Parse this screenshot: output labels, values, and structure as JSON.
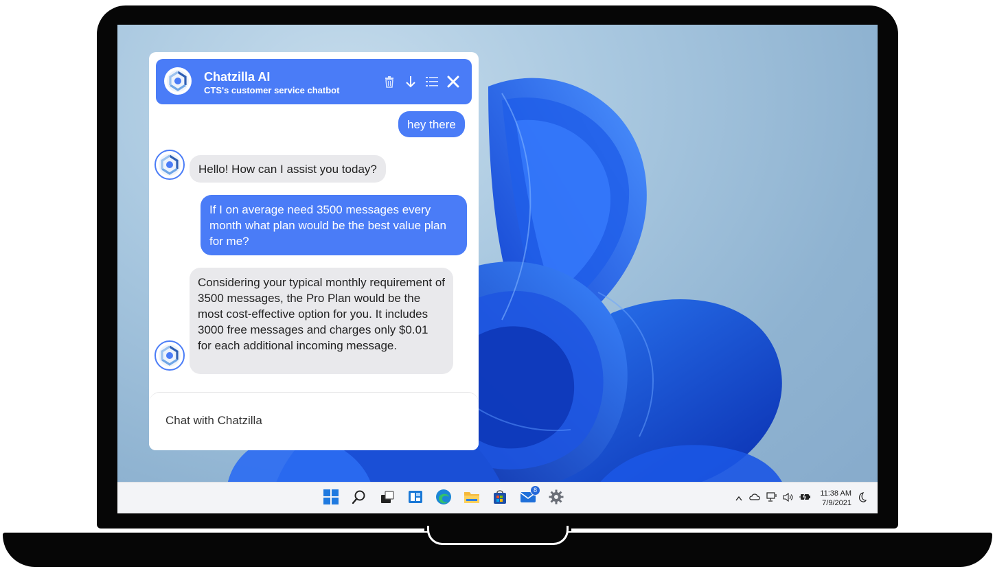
{
  "chat": {
    "title": "Chatzilla AI",
    "subtitle": "CTS's customer service chatbot",
    "messages": [
      {
        "role": "user",
        "text": "hey there"
      },
      {
        "role": "bot",
        "text": "Hello! How can I assist you today?"
      },
      {
        "role": "user",
        "text": "If I on average need 3500 messages every month what plan would be the best value plan for me?"
      },
      {
        "role": "bot",
        "text": "Considering your typical monthly requirement of 3500 messages, the Pro Plan would be the most cost-effective option for you. It includes 3000 free messages and charges only $0.01 for each additional incoming message."
      }
    ],
    "input_placeholder": "Chat with Chatzilla",
    "header_icons": [
      "trash-icon",
      "arrow-down-icon",
      "list-icon",
      "close-icon"
    ]
  },
  "taskbar": {
    "icons": [
      "windows-start-icon",
      "search-icon",
      "task-view-icon",
      "widgets-icon",
      "edge-icon",
      "file-explorer-icon",
      "store-icon",
      "mail-icon",
      "settings-icon"
    ],
    "mail_badge": "8",
    "tray_icons": [
      "chevron-up-icon",
      "onedrive-icon",
      "network-icon",
      "volume-icon",
      "battery-icon",
      "moon-icon"
    ],
    "time": "11:38 AM",
    "date": "7/9/2021"
  },
  "colors": {
    "accent": "#4a7cf7",
    "bot_bubble": "#e9e9ec",
    "wallpaper_blue": "#1a56e0"
  }
}
